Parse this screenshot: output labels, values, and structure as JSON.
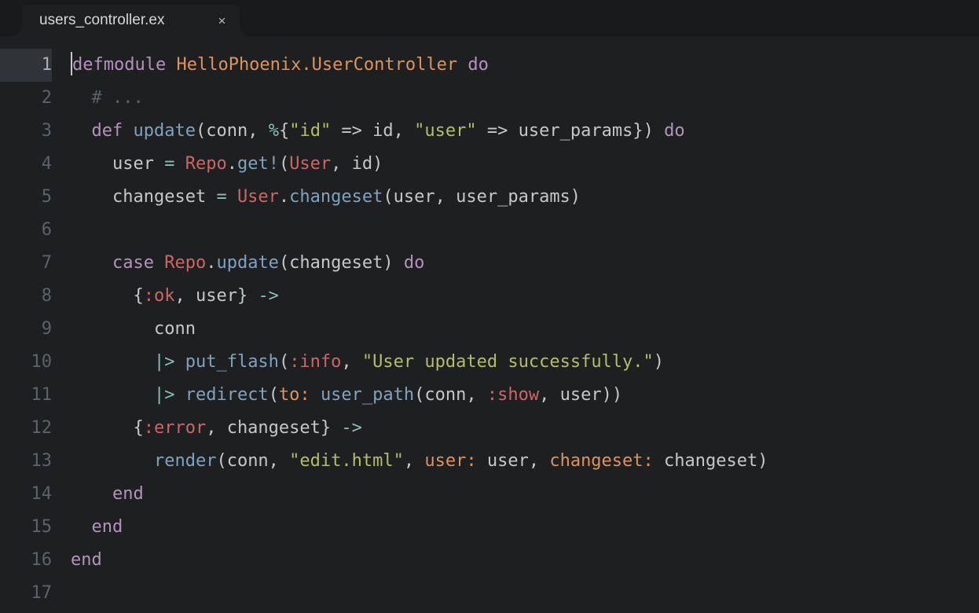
{
  "tab": {
    "filename": "users_controller.ex",
    "close_label": "×"
  },
  "gutter": {
    "active_line": 1,
    "numbers": [
      "1",
      "2",
      "3",
      "4",
      "5",
      "6",
      "7",
      "8",
      "9",
      "10",
      "11",
      "12",
      "13",
      "14",
      "15",
      "16",
      "17"
    ]
  },
  "code": {
    "l1": {
      "defmodule": "defmodule",
      "mod": "HelloPhoenix.UserController",
      "do": "do"
    },
    "l2": {
      "comment": "# ..."
    },
    "l3": {
      "def": "def",
      "fn": "update",
      "open": "(conn, ",
      "pct": "%",
      "brace": "{",
      "k1": "\"id\"",
      "arr1": " => ",
      "v1": "id, ",
      "k2": "\"user\"",
      "arr2": " => ",
      "v2": "user_params",
      "close": "})",
      "do": " do"
    },
    "l4": {
      "pre": "    user ",
      "eq": "=",
      "sp": " ",
      "repo": "Repo",
      "dot": ".",
      "get": "get!",
      "open": "(",
      "user": "User",
      "rest": ", id)"
    },
    "l5": {
      "pre": "    changeset ",
      "eq": "=",
      "sp": " ",
      "user": "User",
      "dot": ".",
      "cs": "changeset",
      "rest": "(user, user_params)"
    },
    "l7": {
      "pre": "    ",
      "case": "case",
      "sp": " ",
      "repo": "Repo",
      "dot": ".",
      "upd": "update",
      "args": "(changeset) ",
      "do": "do"
    },
    "l8": {
      "pre": "      {",
      "ok": ":ok",
      "rest": ", user} ",
      "arr": "->"
    },
    "l9": {
      "text": "        conn"
    },
    "l10": {
      "pre": "        ",
      "pipe": "|>",
      "sp": " ",
      "fn": "put_flash",
      "open": "(",
      "atom": ":info",
      "comma": ", ",
      "str": "\"User updated successfully.\"",
      "close": ")"
    },
    "l11": {
      "pre": "        ",
      "pipe": "|>",
      "sp": " ",
      "fn": "redirect",
      "open": "(",
      "kw": "to:",
      "sp2": " ",
      "fn2": "user_path",
      "open2": "(conn, ",
      "atom": ":show",
      "rest": ", user))"
    },
    "l12": {
      "pre": "      {",
      "err": ":error",
      "rest": ", changeset} ",
      "arr": "->"
    },
    "l13": {
      "pre": "        ",
      "fn": "render",
      "open": "(conn, ",
      "str": "\"edit.html\"",
      "comma": ", ",
      "kw1": "user:",
      "v1": " user, ",
      "kw2": "changeset:",
      "v2": " changeset)"
    },
    "l14": {
      "pre": "    ",
      "end": "end"
    },
    "l15": {
      "pre": "  ",
      "end": "end"
    },
    "l16": {
      "end": "end"
    }
  }
}
